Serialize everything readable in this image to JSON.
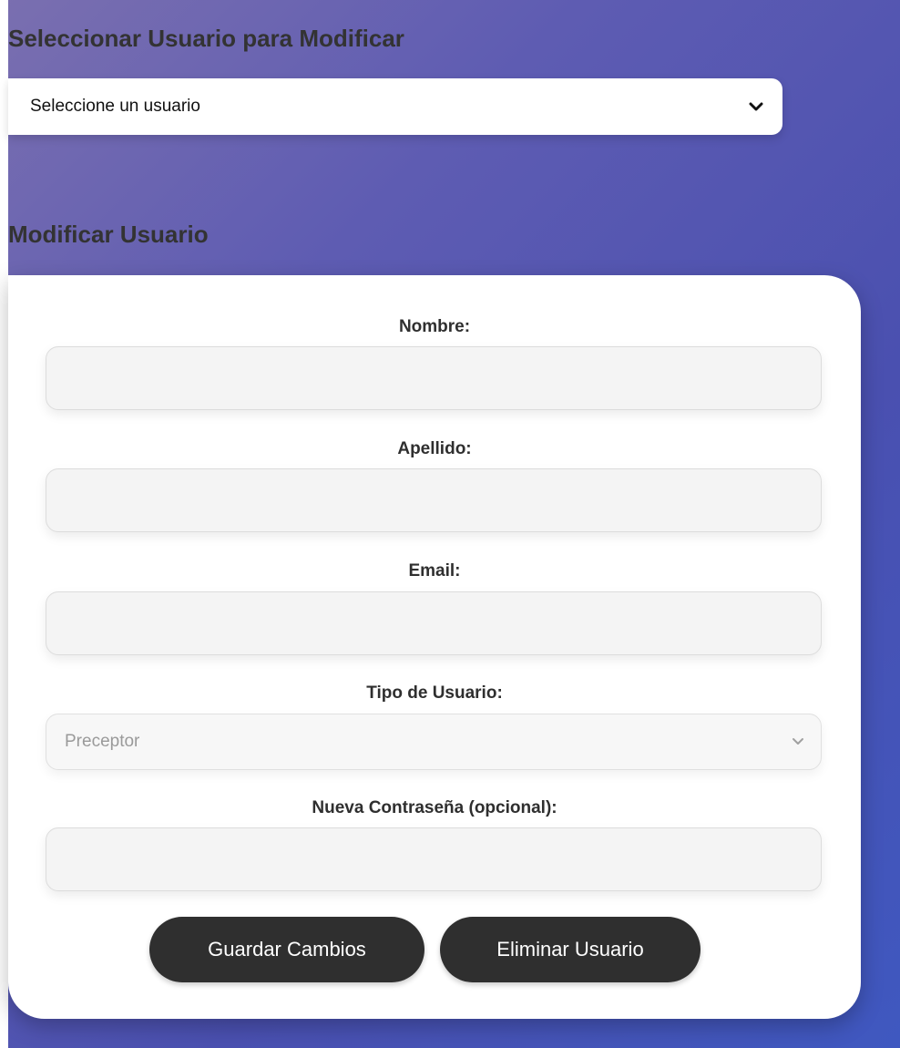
{
  "select_section": {
    "title": "Seleccionar Usuario para Modificar",
    "user_select_value": "Seleccione un usuario"
  },
  "modify_section": {
    "title": "Modificar Usuario",
    "fields": {
      "nombre_label": "Nombre:",
      "apellido_label": "Apellido:",
      "email_label": "Email:",
      "tipo_label": "Tipo de Usuario:",
      "tipo_value": "Preceptor",
      "password_label": "Nueva Contraseña (opcional):"
    },
    "buttons": {
      "save_label": "Guardar Cambios",
      "delete_label": "Eliminar Usuario"
    }
  },
  "icons": {
    "user_select_chevron": "chevron-down-icon",
    "tipo_select_chevron": "chevron-down-icon"
  },
  "colors": {
    "background_gradient_start": "#7a6fb0",
    "background_gradient_end": "#3f58c0",
    "button_background": "#2f2f2f",
    "card_background": "#ffffff",
    "input_background": "#f4f4f4"
  }
}
